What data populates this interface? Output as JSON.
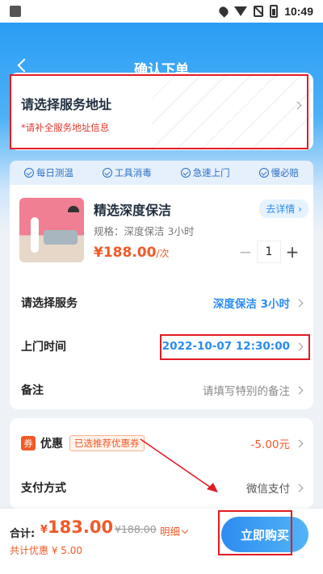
{
  "status_bar": {
    "time": "10:49",
    "icons": [
      "location-icon",
      "wifi-icon",
      "no-sim-icon",
      "battery-icon"
    ]
  },
  "header": {
    "title": "确认下单",
    "back_icon": "chevron-left-icon"
  },
  "address": {
    "title": "请选择服务地址",
    "hint": "*请补全服务地址信息"
  },
  "features": [
    {
      "label": "每日测温"
    },
    {
      "label": "工具消毒"
    },
    {
      "label": "急速上门"
    },
    {
      "label": "慢必赔"
    }
  ],
  "product": {
    "name": "精选深度保洁",
    "spec": "规格：深度保洁 3小时",
    "price": "¥188.00",
    "price_unit": "/次",
    "detail_label": "去详情",
    "quantity": "1"
  },
  "rows": {
    "service": {
      "label": "请选择服务",
      "value": "深度保洁 3小时"
    },
    "time": {
      "label": "上门时间",
      "value": "2022-10-07 12:30:00"
    },
    "remark": {
      "label": "备注",
      "placeholder": "请填写特别的备注"
    }
  },
  "coupon": {
    "icon_text": "券",
    "label": "优惠",
    "tag": "已选推荐优惠券",
    "amount": "-5.00元"
  },
  "payment": {
    "label": "支付方式",
    "value": "微信支付"
  },
  "bottom": {
    "total_label": "合计:",
    "currency": "¥",
    "total": "183.00",
    "original": "¥188.00",
    "detail_link": "明细",
    "saved": "共计优惠 ¥ 5.00",
    "buy_label": "立即购买"
  },
  "colors": {
    "primary": "#2a8cf0",
    "accent": "#f05a28",
    "highlight": "#e31b23"
  }
}
